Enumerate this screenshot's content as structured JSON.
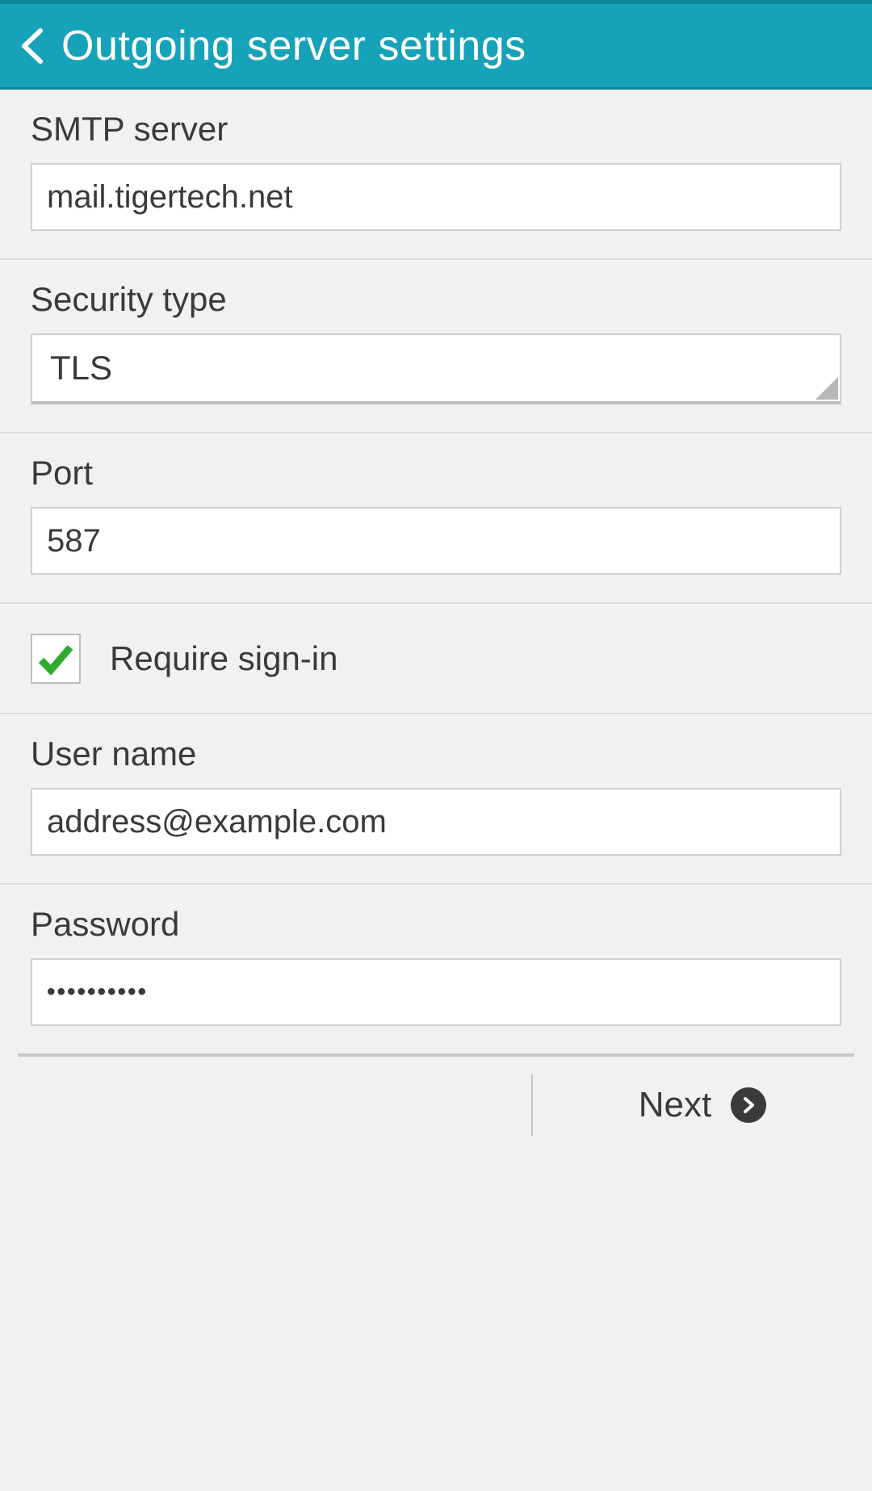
{
  "header": {
    "title": "Outgoing server settings"
  },
  "form": {
    "smtp": {
      "label": "SMTP server",
      "value": "mail.tigertech.net"
    },
    "security": {
      "label": "Security type",
      "value": "TLS"
    },
    "port": {
      "label": "Port",
      "value": "587"
    },
    "require_signin": {
      "label": "Require sign-in",
      "checked": true
    },
    "username": {
      "label": "User name",
      "value": "address@example.com"
    },
    "password": {
      "label": "Password",
      "value": "••••••••••"
    }
  },
  "footer": {
    "next_label": "Next"
  },
  "colors": {
    "accent": "#16a2b8",
    "check": "#2eab2e"
  }
}
